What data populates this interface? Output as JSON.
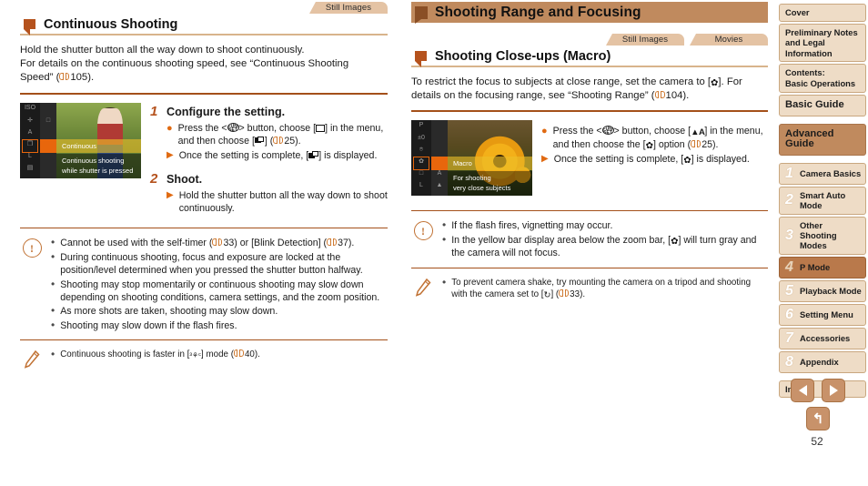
{
  "left_column": {
    "tabs": [
      "Still Images"
    ],
    "section_title": "Continuous Shooting",
    "intro": "Hold the shutter button all the way down to shoot continuously. For details on the continuous shooting speed, see “Continuous Shooting Speed” (",
    "intro_line1": "Hold the shutter button all the way down to shoot continuously.",
    "intro_line2_a": "For details on the continuous shooting speed, see “Continuous Shooting",
    "intro_line2_b": "Speed” (",
    "intro_ref_page": "105",
    "intro_tail": ").",
    "screenshot": {
      "menu_label": "Continuous",
      "desc_line1": "Continuous shooting",
      "desc_line2": "while shutter is pressed"
    },
    "steps": [
      {
        "number": "1",
        "title": "Configure the setting.",
        "bullets": [
          {
            "marker": "dot",
            "pre": "Press the <",
            "key": "FUNC. SET",
            "mid": "> button, choose [",
            "icon1": "single-frame-icon",
            "mid2": "] in the menu, and then choose [",
            "icon2": "continuous-shooting-icon",
            "mid3": "] (",
            "ref": "25",
            "post": ")."
          },
          {
            "marker": "triangle",
            "pre": "Once the setting is complete, [",
            "icon1": "continuous-shooting-icon",
            "post": "] is displayed."
          }
        ]
      },
      {
        "number": "2",
        "title": "Shoot.",
        "bullets": [
          {
            "marker": "triangle",
            "pre": "Hold the shutter button all the way down to shoot continuously."
          }
        ]
      }
    ],
    "caution": {
      "icon": "caution-icon",
      "items": [
        {
          "text_a": "Cannot be used with the self-timer (",
          "ref1": "33",
          "text_b": ") or [Blink Detection] (",
          "ref2": "37",
          "text_c": ")."
        },
        {
          "text_a": "During continuous shooting, focus and exposure are locked at the position/level determined when you pressed the shutter button halfway."
        },
        {
          "text_a": "Shooting may stop momentarily or continuous shooting may slow down depending on shooting conditions, camera settings, and the zoom position."
        },
        {
          "text_a": "As more shots are taken, shooting may slow down."
        },
        {
          "text_a": "Shooting may slow down if the flash fires."
        }
      ]
    },
    "note": {
      "icon": "pencil-note-icon",
      "items": [
        {
          "text_a": "Continuous shooting is faster in [",
          "icon": "burst-mode-icon",
          "text_b": "] mode (",
          "ref1": "40",
          "text_c": ")."
        }
      ]
    }
  },
  "right_column": {
    "band_title": "Shooting Range and Focusing",
    "tabs": [
      "Still Images",
      "Movies"
    ],
    "section_title": "Shooting Close-ups (Macro)",
    "intro_line1_a": "To restrict the focus to subjects at close range, set the camera to [",
    "intro_icon": "macro-icon",
    "intro_line1_b": "]. For",
    "intro_line2_a": "details on the focusing range, see “Shooting Range” (",
    "intro_ref_page": "104",
    "intro_line2_b": ").",
    "screenshot": {
      "menu_label": "Macro",
      "desc_line1": "For shooting",
      "desc_line2": "very close subjects"
    },
    "bullets": [
      {
        "marker": "dot",
        "pre": "Press the <",
        "key": "FUNC. SET",
        "mid": "> button, choose [",
        "icon1": "normal-focus-icon",
        "mid2": "] in the menu, and then choose the [",
        "icon2": "macro-icon",
        "mid3": "] option (",
        "ref": "25",
        "post": ")."
      },
      {
        "marker": "triangle",
        "pre": "Once the setting is complete, [",
        "icon1": "macro-icon",
        "post": "] is displayed."
      }
    ],
    "caution": {
      "icon": "caution-icon",
      "items": [
        {
          "text_a": "If the flash fires, vignetting may occur."
        },
        {
          "text_a": "In the yellow bar display area below the zoom bar, [",
          "icon": "macro-icon",
          "text_b": "] will turn gray and the camera will not focus."
        }
      ]
    },
    "note": {
      "icon": "pencil-note-icon",
      "items": [
        {
          "text_a": "To prevent camera shake, try mounting the camera on a tripod and shooting with the camera set to [",
          "icon": "self-timer-icon",
          "text_b": "] (",
          "ref1": "33",
          "text_c": ")."
        }
      ]
    }
  },
  "nav": {
    "top_items": [
      {
        "label": "Cover",
        "type": "plain"
      },
      {
        "label": "Preliminary Notes and Legal Information",
        "type": "plain"
      },
      {
        "label": "Contents:\nBasic Operations",
        "type": "plain"
      },
      {
        "label": "Basic Guide",
        "type": "big"
      },
      {
        "label": "Advanced Guide",
        "type": "guide"
      }
    ],
    "cover_label": "Cover",
    "prelim_label": "Preliminary Notes and Legal Information",
    "contents_label_1": "Contents:",
    "contents_label_2": "Basic Operations",
    "basic_guide_label": "Basic Guide",
    "advanced_guide_label": "Advanced Guide",
    "chapters": [
      {
        "num": "1",
        "label": "Camera Basics",
        "active": false
      },
      {
        "num": "2",
        "label": "Smart Auto Mode",
        "active": false
      },
      {
        "num": "3",
        "label": "Other Shooting Modes",
        "active": false
      },
      {
        "num": "4",
        "label": "P Mode",
        "active": true
      },
      {
        "num": "5",
        "label": "Playback Mode",
        "active": false
      },
      {
        "num": "6",
        "label": "Setting Menu",
        "active": false
      },
      {
        "num": "7",
        "label": "Accessories",
        "active": false
      },
      {
        "num": "8",
        "label": "Appendix",
        "active": false
      }
    ],
    "index_label": "Index"
  },
  "footer": {
    "prev_button": "previous-page",
    "next_button": "next-page",
    "back_button": "back",
    "page_number": "52"
  },
  "colors": {
    "band_bg": "#c08a5e",
    "marker_orange": "#b5521d",
    "tab_bg": "#e4c3a4",
    "nav_bg": "#eedcc6",
    "nav_active": "#b9794b",
    "rule": "#a4501a",
    "accent_orange": "#e06a12"
  }
}
